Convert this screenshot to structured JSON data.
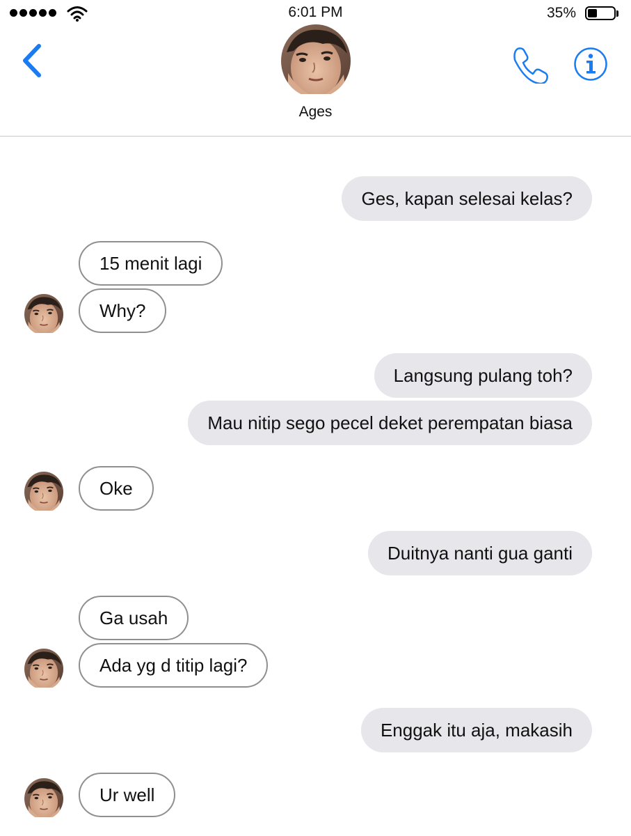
{
  "status_bar": {
    "time": "6:01 PM",
    "battery_percent": "35%",
    "battery_level": 0.35,
    "signal_dots": 5,
    "icons": [
      "signal-dots",
      "wifi-icon",
      "battery-icon"
    ]
  },
  "header": {
    "contact_name": "Ages",
    "icons": [
      "back-chevron-icon",
      "avatar",
      "phone-icon",
      "info-icon"
    ],
    "accent_color": "#1a7cf0"
  },
  "messages": [
    {
      "direction": "outgoing",
      "text": "Ges, kapan selesai kelas?"
    },
    {
      "direction": "incoming",
      "text": "15 menit lagi"
    },
    {
      "direction": "incoming",
      "text": "Why?"
    },
    {
      "direction": "outgoing",
      "text": "Langsung pulang toh?"
    },
    {
      "direction": "outgoing",
      "text": "Mau nitip sego pecel deket perempatan biasa"
    },
    {
      "direction": "incoming",
      "text": "Oke"
    },
    {
      "direction": "outgoing",
      "text": "Duitnya nanti gua ganti"
    },
    {
      "direction": "incoming",
      "text": "Ga usah"
    },
    {
      "direction": "incoming",
      "text": "Ada yg d titip lagi?"
    },
    {
      "direction": "outgoing",
      "text": "Enggak itu aja, makasih"
    },
    {
      "direction": "incoming",
      "text": "Ur well"
    }
  ],
  "colors": {
    "outgoing_bubble": "#e6e6eb",
    "incoming_border": "#8f8f8f",
    "divider": "#c8c8cc"
  }
}
